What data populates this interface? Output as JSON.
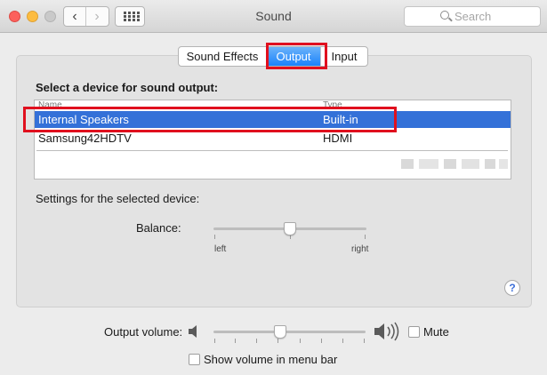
{
  "window": {
    "title": "Sound"
  },
  "toolbar": {
    "search_placeholder": "Search"
  },
  "tabs": [
    {
      "label": "Sound Effects",
      "selected": false
    },
    {
      "label": "Output",
      "selected": true
    },
    {
      "label": "Input",
      "selected": false
    }
  ],
  "output": {
    "heading": "Select a device for sound output:",
    "columns": [
      "Name",
      "Type"
    ],
    "devices": [
      {
        "name": "Internal Speakers",
        "type": "Built-in",
        "selected": true
      },
      {
        "name": "Samsung42HDTV",
        "type": "HDMI",
        "selected": false
      }
    ],
    "settings_label": "Settings for the selected device:",
    "balance": {
      "label": "Balance:",
      "left_label": "left",
      "right_label": "right",
      "value": 0.5
    }
  },
  "help": {
    "glyph": "?"
  },
  "volume": {
    "label": "Output volume:",
    "value": 0.44,
    "mute_label": "Mute",
    "mute_checked": false
  },
  "menu_bar_option": {
    "label": "Show volume in menu bar",
    "checked": false
  },
  "colors": {
    "accent": "#3471d8",
    "highlight_box": "#e0101e"
  },
  "icons": [
    "back-chevron-icon",
    "forward-chevron-icon",
    "grid-icon",
    "search-icon",
    "speaker-low-icon",
    "speaker-high-icon",
    "help-icon"
  ]
}
